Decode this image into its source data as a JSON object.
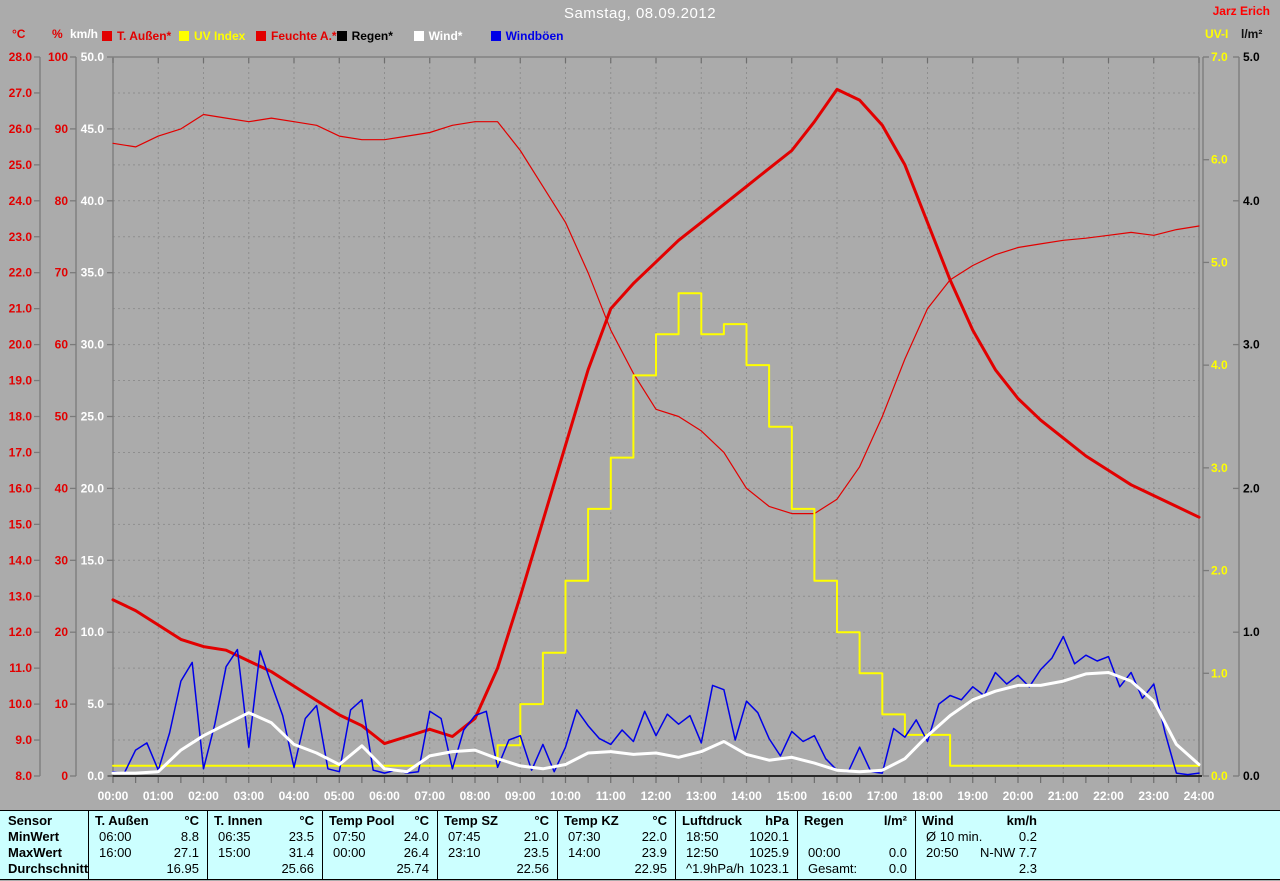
{
  "header": {
    "title": "Samstag, 08.09.2012",
    "watermark": "Jarz Erich",
    "units": {
      "c": "°C",
      "pct": "%",
      "kmh": "km/h",
      "uv": "UV-I",
      "lm2": "l/m²"
    },
    "legend": [
      {
        "label": "T. Außen*",
        "color": "#e20000"
      },
      {
        "label": "UV Index",
        "color": "#ffff00"
      },
      {
        "label": "Feuchte A.*",
        "color": "#e20000"
      },
      {
        "label": "Regen*",
        "color": "#000000"
      },
      {
        "label": "Wind*",
        "color": "#ffffff"
      },
      {
        "label": "Windböen",
        "color": "#0000e8"
      }
    ]
  },
  "colors": {
    "background": "#ababab",
    "grid": "#8e8e8e",
    "axis_gray": "#7a7a7a",
    "axis_black": "#000000",
    "tick_mark": "#6e6e6e",
    "x_label": "#ffffff",
    "table_bg": "#ccffff"
  },
  "chart_data": {
    "type": "line",
    "title": "Samstag, 08.09.2012",
    "grid": "on",
    "x_axis": {
      "unit": "time",
      "labels": [
        "00:00",
        "01:00",
        "02:00",
        "03:00",
        "04:00",
        "05:00",
        "06:00",
        "07:00",
        "08:00",
        "09:00",
        "10:00",
        "11:00",
        "12:00",
        "13:00",
        "14:00",
        "15:00",
        "16:00",
        "17:00",
        "18:00",
        "19:00",
        "20:00",
        "21:00",
        "22:00",
        "23:00",
        "24:00"
      ]
    },
    "axes": {
      "temp_c": {
        "label": "°C",
        "min": 8,
        "max": 28,
        "tick_step": 1,
        "decimals": 1,
        "color": "#e20000"
      },
      "humidity_pct": {
        "label": "%",
        "min": 0,
        "max": 100,
        "tick_step": 10,
        "decimals": 0,
        "color": "#e20000"
      },
      "wind_kmh": {
        "label": "km/h",
        "min": 0,
        "max": 50,
        "tick_step": 5,
        "decimals": 1,
        "color": "#ffffff"
      },
      "uv_index": {
        "label": "UV-I",
        "min": 0,
        "max": 7,
        "tick_step": 1,
        "decimals": 1,
        "color": "#ffff00"
      },
      "rain_lm2": {
        "label": "l/m²",
        "min": 0,
        "max": 5,
        "tick_step": 1,
        "decimals": 1,
        "color": "#000000"
      }
    },
    "series": [
      {
        "key": "feuchte",
        "name": "Feuchte A.",
        "axis": "humidity_pct",
        "color": "#e20000",
        "width": 1.2,
        "x_start": 0,
        "x_step_hours": 0.5,
        "values": [
          88,
          87.5,
          89,
          90,
          92,
          91.5,
          91,
          91.5,
          91,
          90.5,
          89,
          88.5,
          88.5,
          89,
          89.5,
          90.5,
          91,
          91,
          87,
          82,
          77,
          70,
          62,
          56,
          51,
          50,
          48,
          45,
          40,
          37.5,
          36.5,
          36.5,
          38.5,
          43,
          50,
          58,
          65,
          69,
          71,
          72.5,
          73.5,
          74,
          74.5,
          74.8,
          75.2,
          75.6,
          75.2,
          76,
          76.5
        ]
      },
      {
        "key": "temp",
        "name": "T. Außen",
        "axis": "temp_c",
        "color": "#e20000",
        "width": 3,
        "x_start": 0,
        "x_step_hours": 0.5,
        "values": [
          12.9,
          12.6,
          12.2,
          11.8,
          11.6,
          11.5,
          11.2,
          10.9,
          10.5,
          10.1,
          9.7,
          9.4,
          8.9,
          9.1,
          9.3,
          9.1,
          9.6,
          11.0,
          13.0,
          15.1,
          17.2,
          19.3,
          21.0,
          21.7,
          22.3,
          22.9,
          23.4,
          23.9,
          24.4,
          24.9,
          25.4,
          26.2,
          27.1,
          26.8,
          26.1,
          25.0,
          23.4,
          21.8,
          20.4,
          19.3,
          18.5,
          17.9,
          17.4,
          16.9,
          16.5,
          16.1,
          15.8,
          15.5,
          15.2
        ]
      },
      {
        "key": "uv",
        "name": "UV Index",
        "axis": "uv_index",
        "color": "#ffff00",
        "width": 2,
        "step": true,
        "x_start": 0,
        "x_step_hours": 0.5,
        "values": [
          0.1,
          0.1,
          0.1,
          0.1,
          0.1,
          0.1,
          0.1,
          0.1,
          0.1,
          0.1,
          0.1,
          0.1,
          0.1,
          0.1,
          0.1,
          0.1,
          0.1,
          0.3,
          0.7,
          1.2,
          1.9,
          2.6,
          3.1,
          3.9,
          4.3,
          4.7,
          4.3,
          4.4,
          4.0,
          3.4,
          2.6,
          1.9,
          1.4,
          1.0,
          0.6,
          0.4,
          0.4,
          0.1,
          0.1,
          0.1,
          0.1,
          0.1,
          0.1,
          0.1,
          0.1,
          0.1,
          0.1,
          0.1,
          0.1
        ]
      },
      {
        "key": "boen",
        "name": "Windböen",
        "axis": "wind_kmh",
        "color": "#0000e8",
        "width": 1.5,
        "x_start": 0,
        "x_step_hours": 0.25,
        "values": [
          0.3,
          0.2,
          1.8,
          2.3,
          0.4,
          3.0,
          6.6,
          7.9,
          0.5,
          3.6,
          7.6,
          8.8,
          2.0,
          8.7,
          6.4,
          4.2,
          0.6,
          4.0,
          4.9,
          0.5,
          0.3,
          4.6,
          5.3,
          0.4,
          0.2,
          0.4,
          0.2,
          0.3,
          4.5,
          4.0,
          0.5,
          3.2,
          4.2,
          4.5,
          0.6,
          2.5,
          2.8,
          0.4,
          2.2,
          0.3,
          2.0,
          4.6,
          3.5,
          2.6,
          2.2,
          3.2,
          2.4,
          4.5,
          2.8,
          4.3,
          3.6,
          4.2,
          2.3,
          6.3,
          6.0,
          2.5,
          5.2,
          4.4,
          2.6,
          1.4,
          3.1,
          2.4,
          2.8,
          1.2,
          0.4,
          0.3,
          2.0,
          0.3,
          0.2,
          3.3,
          2.7,
          3.9,
          2.4,
          5.0,
          5.6,
          5.3,
          6.2,
          5.6,
          7.2,
          6.4,
          7.0,
          6.2,
          7.4,
          8.2,
          9.7,
          7.8,
          8.4,
          8.0,
          8.3,
          6.2,
          7.2,
          5.4,
          6.4,
          3.0,
          0.2,
          0.1,
          0.2
        ]
      },
      {
        "key": "wind",
        "name": "Wind",
        "axis": "wind_kmh",
        "color": "#ffffff",
        "width": 3,
        "x_start": 0,
        "x_step_hours": 0.5,
        "values": [
          0.2,
          0.2,
          0.3,
          1.8,
          2.8,
          3.6,
          4.4,
          3.7,
          2.2,
          1.6,
          0.8,
          2.1,
          0.5,
          0.3,
          1.4,
          1.7,
          1.8,
          1.2,
          0.7,
          0.5,
          0.8,
          1.6,
          1.7,
          1.5,
          1.6,
          1.3,
          1.7,
          2.4,
          1.5,
          1.1,
          1.3,
          0.9,
          0.4,
          0.3,
          0.4,
          1.2,
          2.8,
          4.2,
          5.3,
          5.9,
          6.3,
          6.3,
          6.6,
          7.1,
          7.2,
          6.6,
          5.2,
          2.2,
          0.8
        ]
      },
      {
        "key": "regen",
        "name": "Regen",
        "axis": "rain_lm2",
        "color": "#000000",
        "width": 1,
        "x_start": 0,
        "x_step_hours": 24,
        "values": [
          0,
          0
        ]
      }
    ]
  },
  "stats_table": {
    "row_labels": [
      "Sensor",
      "MinWert",
      "MaxWert",
      "Durchschnitt"
    ],
    "columns": [
      {
        "name": "T. Außen",
        "unit": "°C",
        "rows": [
          [
            "06:00",
            "8.8"
          ],
          [
            "16:00",
            "27.1"
          ],
          [
            "",
            "16.95"
          ]
        ]
      },
      {
        "name": "T. Innen",
        "unit": "°C",
        "rows": [
          [
            "06:35",
            "23.5"
          ],
          [
            "15:00",
            "31.4"
          ],
          [
            "",
            "25.66"
          ]
        ]
      },
      {
        "name": "Temp Pool",
        "unit": "°C",
        "rows": [
          [
            "07:50",
            "24.0"
          ],
          [
            "00:00",
            "26.4"
          ],
          [
            "",
            "25.74"
          ]
        ]
      },
      {
        "name": "Temp SZ",
        "unit": "°C",
        "rows": [
          [
            "07:45",
            "21.0"
          ],
          [
            "23:10",
            "23.5"
          ],
          [
            "",
            "22.56"
          ]
        ]
      },
      {
        "name": "Temp KZ",
        "unit": "°C",
        "rows": [
          [
            "07:30",
            "22.0"
          ],
          [
            "14:00",
            "23.9"
          ],
          [
            "",
            "22.95"
          ]
        ]
      },
      {
        "name": "Luftdruck",
        "unit": "hPa",
        "rows": [
          [
            "18:50",
            "1020.1"
          ],
          [
            "12:50",
            "1025.9"
          ],
          [
            "^1.9hPa/h",
            "1023.1"
          ]
        ]
      },
      {
        "name": "Regen",
        "unit": "l/m²",
        "rows": [
          [
            "",
            ""
          ],
          [
            "00:00",
            "0.0"
          ],
          [
            "Gesamt:",
            "0.0"
          ]
        ]
      },
      {
        "name": "Wind",
        "unit": "km/h",
        "rows": [
          [
            "Ø 10 min.",
            "0.2"
          ],
          [
            "20:50",
            "N-NW 7.7"
          ],
          [
            "",
            "2.3"
          ]
        ]
      }
    ]
  }
}
